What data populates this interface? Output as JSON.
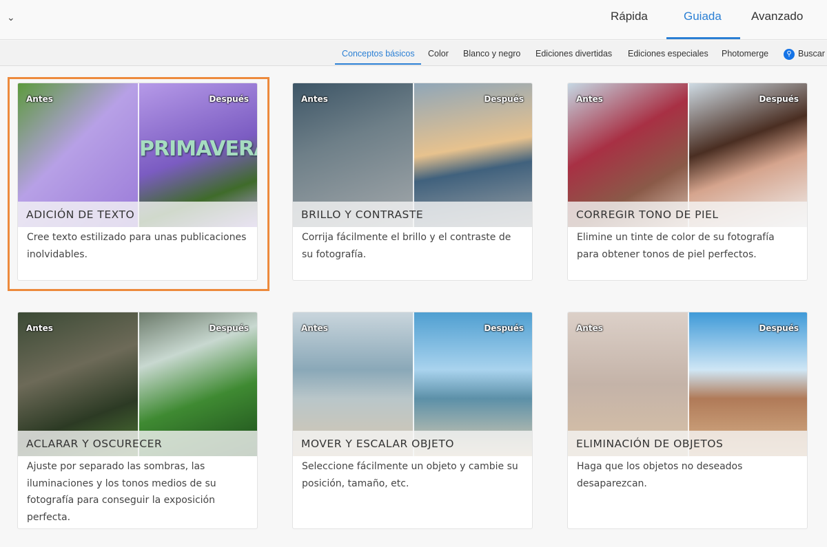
{
  "header": {
    "collapse_icon": "chevron-down-icon",
    "modes": [
      "Rápida",
      "Guiada",
      "Avanzado"
    ],
    "active_mode": "Guiada"
  },
  "subnav": {
    "items": [
      "Conceptos básicos",
      "Color",
      "Blanco y negro",
      "Ediciones divertidas",
      "Ediciones especiales",
      "Photomerge"
    ],
    "active": "Conceptos básicos",
    "search_label": "Buscar",
    "search_icon": "search-icon"
  },
  "labels": {
    "before": "Antes",
    "after": "Después"
  },
  "cards": [
    {
      "title": "ADICIÓN DE TEXTO",
      "desc": "Cree texto estilizado para unas publicaciones inolvidables.",
      "overlay_text": "PRIMAVERA",
      "selected": true
    },
    {
      "title": "BRILLO Y CONTRASTE",
      "desc": "Corrija fácilmente el brillo y el contraste de su fotografía."
    },
    {
      "title": "CORREGIR TONO DE PIEL",
      "desc": "Elimine un tinte de color de su fotografía para obtener tonos de piel perfectos."
    },
    {
      "title": "ACLARAR Y OSCURECER",
      "desc": "Ajuste por separado las sombras, las iluminaciones y los tonos medios de su fotografía para conseguir la exposición perfecta."
    },
    {
      "title": "MOVER Y ESCALAR OBJETO",
      "desc": "Seleccione fácilmente un objeto y cambie su posición, tamaño, etc."
    },
    {
      "title": "ELIMINACIÓN DE OBJETOS",
      "desc": "Haga que los objetos no deseados desaparezcan."
    }
  ],
  "colors": {
    "accent": "#2a7fd4",
    "selection": "#ed8a3c"
  }
}
